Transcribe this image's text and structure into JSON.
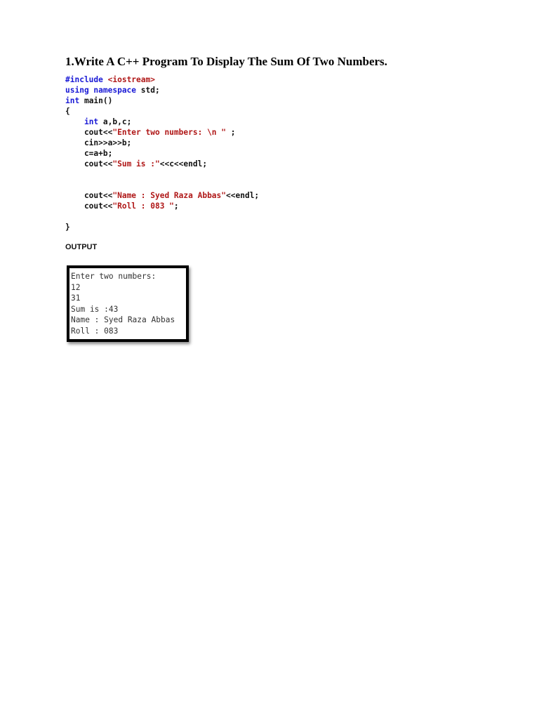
{
  "title": "1.Write A C++ Program To Display The Sum Of Two Numbers.",
  "code_lines": [
    [
      {
        "t": "#include ",
        "c": "kw"
      },
      {
        "t": "<iostream>",
        "c": "str"
      }
    ],
    [
      {
        "t": "using namespace ",
        "c": "kw"
      },
      {
        "t": "std;",
        "c": "pl"
      }
    ],
    [
      {
        "t": "int ",
        "c": "kw"
      },
      {
        "t": "main()",
        "c": "pl"
      }
    ],
    [
      {
        "t": "{",
        "c": "pl"
      }
    ],
    [
      {
        "t": "    ",
        "c": "pl"
      },
      {
        "t": "int ",
        "c": "kw"
      },
      {
        "t": "a,b,c;",
        "c": "pl"
      }
    ],
    [
      {
        "t": "    cout<<",
        "c": "pl"
      },
      {
        "t": "\"Enter two numbers: \\n \"",
        "c": "str"
      },
      {
        "t": " ;",
        "c": "pl"
      }
    ],
    [
      {
        "t": "    cin>>a>>b;",
        "c": "pl"
      }
    ],
    [
      {
        "t": "    c=a+b;",
        "c": "pl"
      }
    ],
    [
      {
        "t": "    cout<<",
        "c": "pl"
      },
      {
        "t": "\"Sum is :\"",
        "c": "str"
      },
      {
        "t": "<<c<<endl;",
        "c": "pl"
      }
    ],
    [],
    [],
    [
      {
        "t": "    cout<<",
        "c": "pl"
      },
      {
        "t": "\"Name : Syed Raza Abbas\"",
        "c": "str"
      },
      {
        "t": "<<endl;",
        "c": "pl"
      }
    ],
    [
      {
        "t": "    cout<<",
        "c": "pl"
      },
      {
        "t": "\"Roll : 083 \"",
        "c": "str"
      },
      {
        "t": ";",
        "c": "pl"
      }
    ],
    [],
    [
      {
        "t": "}",
        "c": "pl"
      }
    ]
  ],
  "output_label": "OUTPUT",
  "console_lines": [
    "Enter two numbers:",
    "12",
    "31",
    "Sum is :43",
    "Name : Syed Raza Abbas",
    "Roll : 083"
  ]
}
